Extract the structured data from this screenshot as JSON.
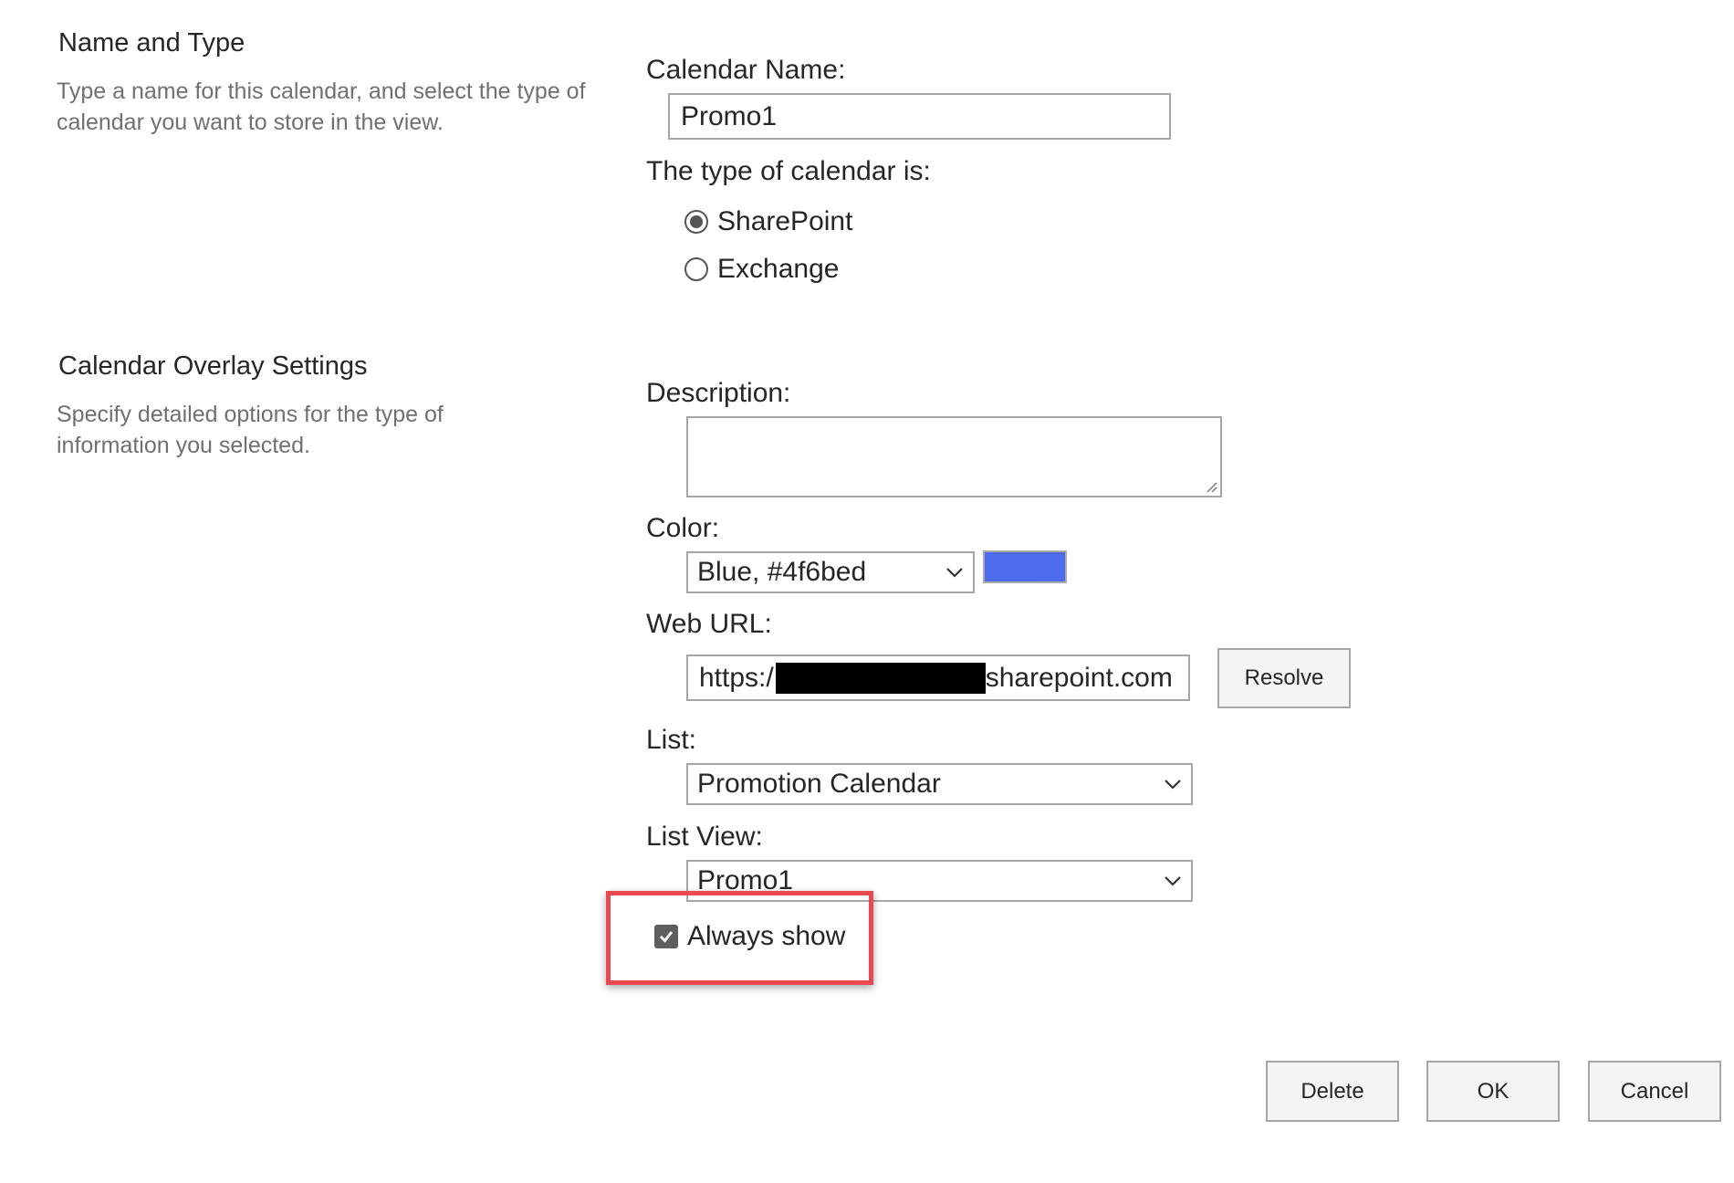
{
  "name_type_section": {
    "title": "Name and Type",
    "description": "Type a name for this calendar, and select the type of calendar you want to store in the view."
  },
  "overlay_section": {
    "title": "Calendar Overlay Settings",
    "description": "Specify detailed options for the type of information you selected."
  },
  "calendar_name": {
    "label": "Calendar Name:",
    "value": "Promo1"
  },
  "calendar_type": {
    "label": "The type of calendar is:",
    "options": [
      {
        "label": "SharePoint",
        "checked": true
      },
      {
        "label": "Exchange",
        "checked": false
      }
    ]
  },
  "description_field": {
    "label": "Description:",
    "value": ""
  },
  "color": {
    "label": "Color:",
    "selected": "Blue, #4f6bed",
    "swatch": "#4f6bed"
  },
  "web_url": {
    "label": "Web URL:",
    "prefix": "https:/",
    "suffix": "sharepoint.com",
    "resolve_label": "Resolve"
  },
  "list": {
    "label": "List:",
    "selected": "Promotion Calendar"
  },
  "list_view": {
    "label": "List View:",
    "selected": "Promo1"
  },
  "always_show": {
    "label": "Always show",
    "checked": true
  },
  "highlight": {
    "color": "#e84a4f"
  },
  "footer_buttons": {
    "delete": "Delete",
    "ok": "OK",
    "cancel": "Cancel"
  }
}
